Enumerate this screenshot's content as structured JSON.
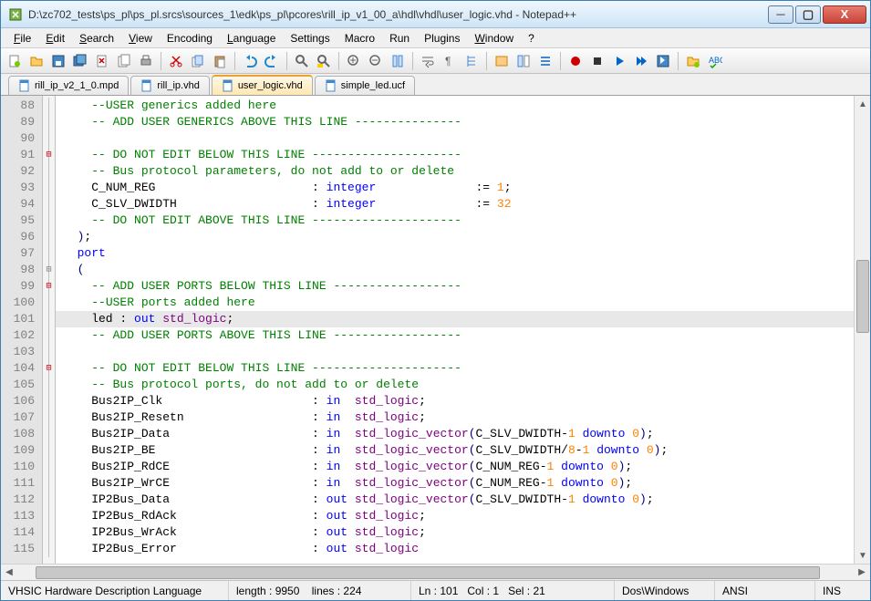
{
  "window": {
    "title": "D:\\zc702_tests\\ps_pl\\ps_pl.srcs\\sources_1\\edk\\ps_pl\\pcores\\rill_ip_v1_00_a\\hdl\\vhdl\\user_logic.vhd - Notepad++"
  },
  "menu": {
    "file": "File",
    "edit": "Edit",
    "search": "Search",
    "view": "View",
    "encoding": "Encoding",
    "language": "Language",
    "settings": "Settings",
    "macro": "Macro",
    "run": "Run",
    "plugins": "Plugins",
    "window": "Window",
    "help": "?"
  },
  "tabs": [
    {
      "label": "rill_ip_v2_1_0.mpd",
      "active": false
    },
    {
      "label": "rill_ip.vhd",
      "active": false
    },
    {
      "label": "user_logic.vhd",
      "active": true
    },
    {
      "label": "simple_led.ucf",
      "active": false
    }
  ],
  "code": {
    "first_line": 88,
    "lines": [
      {
        "n": 88,
        "html": "    <span class='kw-green'>--USER generics added here</span>"
      },
      {
        "n": 89,
        "html": "    <span class='kw-green'>-- ADD USER GENERICS ABOVE THIS LINE ---------------</span>"
      },
      {
        "n": 90,
        "html": ""
      },
      {
        "n": 91,
        "fold": "⊟",
        "html": "    <span class='kw-green'>-- DO NOT EDIT BELOW THIS LINE ---------------------</span>"
      },
      {
        "n": 92,
        "html": "    <span class='kw-green'>-- Bus protocol parameters, do not add to or delete</span>"
      },
      {
        "n": 93,
        "html": "    C_NUM_REG                      : <span class='kw-blue'>integer</span>              := <span class='str-orange'>1</span>;"
      },
      {
        "n": 94,
        "html": "    C_SLV_DWIDTH                   : <span class='kw-blue'>integer</span>              := <span class='str-orange'>32</span>"
      },
      {
        "n": 95,
        "html": "    <span class='kw-green'>-- DO NOT EDIT ABOVE THIS LINE ---------------------</span>"
      },
      {
        "n": 96,
        "html": "  <span class='kw-navy'>)</span>;"
      },
      {
        "n": 97,
        "html": "  <span class='kw-blue'>port</span>"
      },
      {
        "n": 98,
        "fold": "⊟",
        "html": "  <span class='kw-navy'>(</span>"
      },
      {
        "n": 99,
        "fold": "⊟",
        "html": "    <span class='kw-green'>-- ADD USER PORTS BELOW THIS LINE ------------------</span>"
      },
      {
        "n": 100,
        "html": "    <span class='kw-green'>--USER ports added here</span>"
      },
      {
        "n": 101,
        "hl": true,
        "html": "    led : <span class='kw-blue'>out</span> <span class='ident-purple'>std_logic</span>;"
      },
      {
        "n": 102,
        "html": "    <span class='kw-green'>-- ADD USER PORTS ABOVE THIS LINE ------------------</span>"
      },
      {
        "n": 103,
        "html": ""
      },
      {
        "n": 104,
        "fold": "⊟",
        "html": "    <span class='kw-green'>-- DO NOT EDIT BELOW THIS LINE ---------------------</span>"
      },
      {
        "n": 105,
        "html": "    <span class='kw-green'>-- Bus protocol ports, do not add to or delete</span>"
      },
      {
        "n": 106,
        "html": "    Bus2IP_Clk                     : <span class='kw-blue'>in</span>  <span class='ident-purple'>std_logic</span>;"
      },
      {
        "n": 107,
        "html": "    Bus2IP_Resetn                  : <span class='kw-blue'>in</span>  <span class='ident-purple'>std_logic</span>;"
      },
      {
        "n": 108,
        "html": "    Bus2IP_Data                    : <span class='kw-blue'>in</span>  <span class='ident-purple'>std_logic_vector</span><span class='kw-navy'>(</span>C_SLV_DWIDTH-<span class='str-orange'>1</span> <span class='kw-blue'>downto</span> <span class='str-orange'>0</span><span class='kw-navy'>)</span>;"
      },
      {
        "n": 109,
        "html": "    Bus2IP_BE                      : <span class='kw-blue'>in</span>  <span class='ident-purple'>std_logic_vector</span><span class='kw-navy'>(</span>C_SLV_DWIDTH/<span class='str-orange'>8</span>-<span class='str-orange'>1</span> <span class='kw-blue'>downto</span> <span class='str-orange'>0</span><span class='kw-navy'>)</span>;"
      },
      {
        "n": 110,
        "html": "    Bus2IP_RdCE                    : <span class='kw-blue'>in</span>  <span class='ident-purple'>std_logic_vector</span><span class='kw-navy'>(</span>C_NUM_REG-<span class='str-orange'>1</span> <span class='kw-blue'>downto</span> <span class='str-orange'>0</span><span class='kw-navy'>)</span>;"
      },
      {
        "n": 111,
        "html": "    Bus2IP_WrCE                    : <span class='kw-blue'>in</span>  <span class='ident-purple'>std_logic_vector</span><span class='kw-navy'>(</span>C_NUM_REG-<span class='str-orange'>1</span> <span class='kw-blue'>downto</span> <span class='str-orange'>0</span><span class='kw-navy'>)</span>;"
      },
      {
        "n": 112,
        "html": "    IP2Bus_Data                    : <span class='kw-blue'>out</span> <span class='ident-purple'>std_logic_vector</span><span class='kw-navy'>(</span>C_SLV_DWIDTH-<span class='str-orange'>1</span> <span class='kw-blue'>downto</span> <span class='str-orange'>0</span><span class='kw-navy'>)</span>;"
      },
      {
        "n": 113,
        "html": "    IP2Bus_RdAck                   : <span class='kw-blue'>out</span> <span class='ident-purple'>std_logic</span>;"
      },
      {
        "n": 114,
        "html": "    IP2Bus_WrAck                   : <span class='kw-blue'>out</span> <span class='ident-purple'>std_logic</span>;"
      },
      {
        "n": 115,
        "html": "    IP2Bus_Error                   : <span class='kw-blue'>out</span> <span class='ident-purple'>std_logic</span>"
      }
    ]
  },
  "status": {
    "lang": "VHSIC Hardware Description Language",
    "length_label": "length : 9950",
    "lines_label": "lines : 224",
    "ln": "Ln : 101",
    "col": "Col : 1",
    "sel": "Sel : 21",
    "eol": "Dos\\Windows",
    "encoding": "ANSI",
    "ins": "INS"
  }
}
